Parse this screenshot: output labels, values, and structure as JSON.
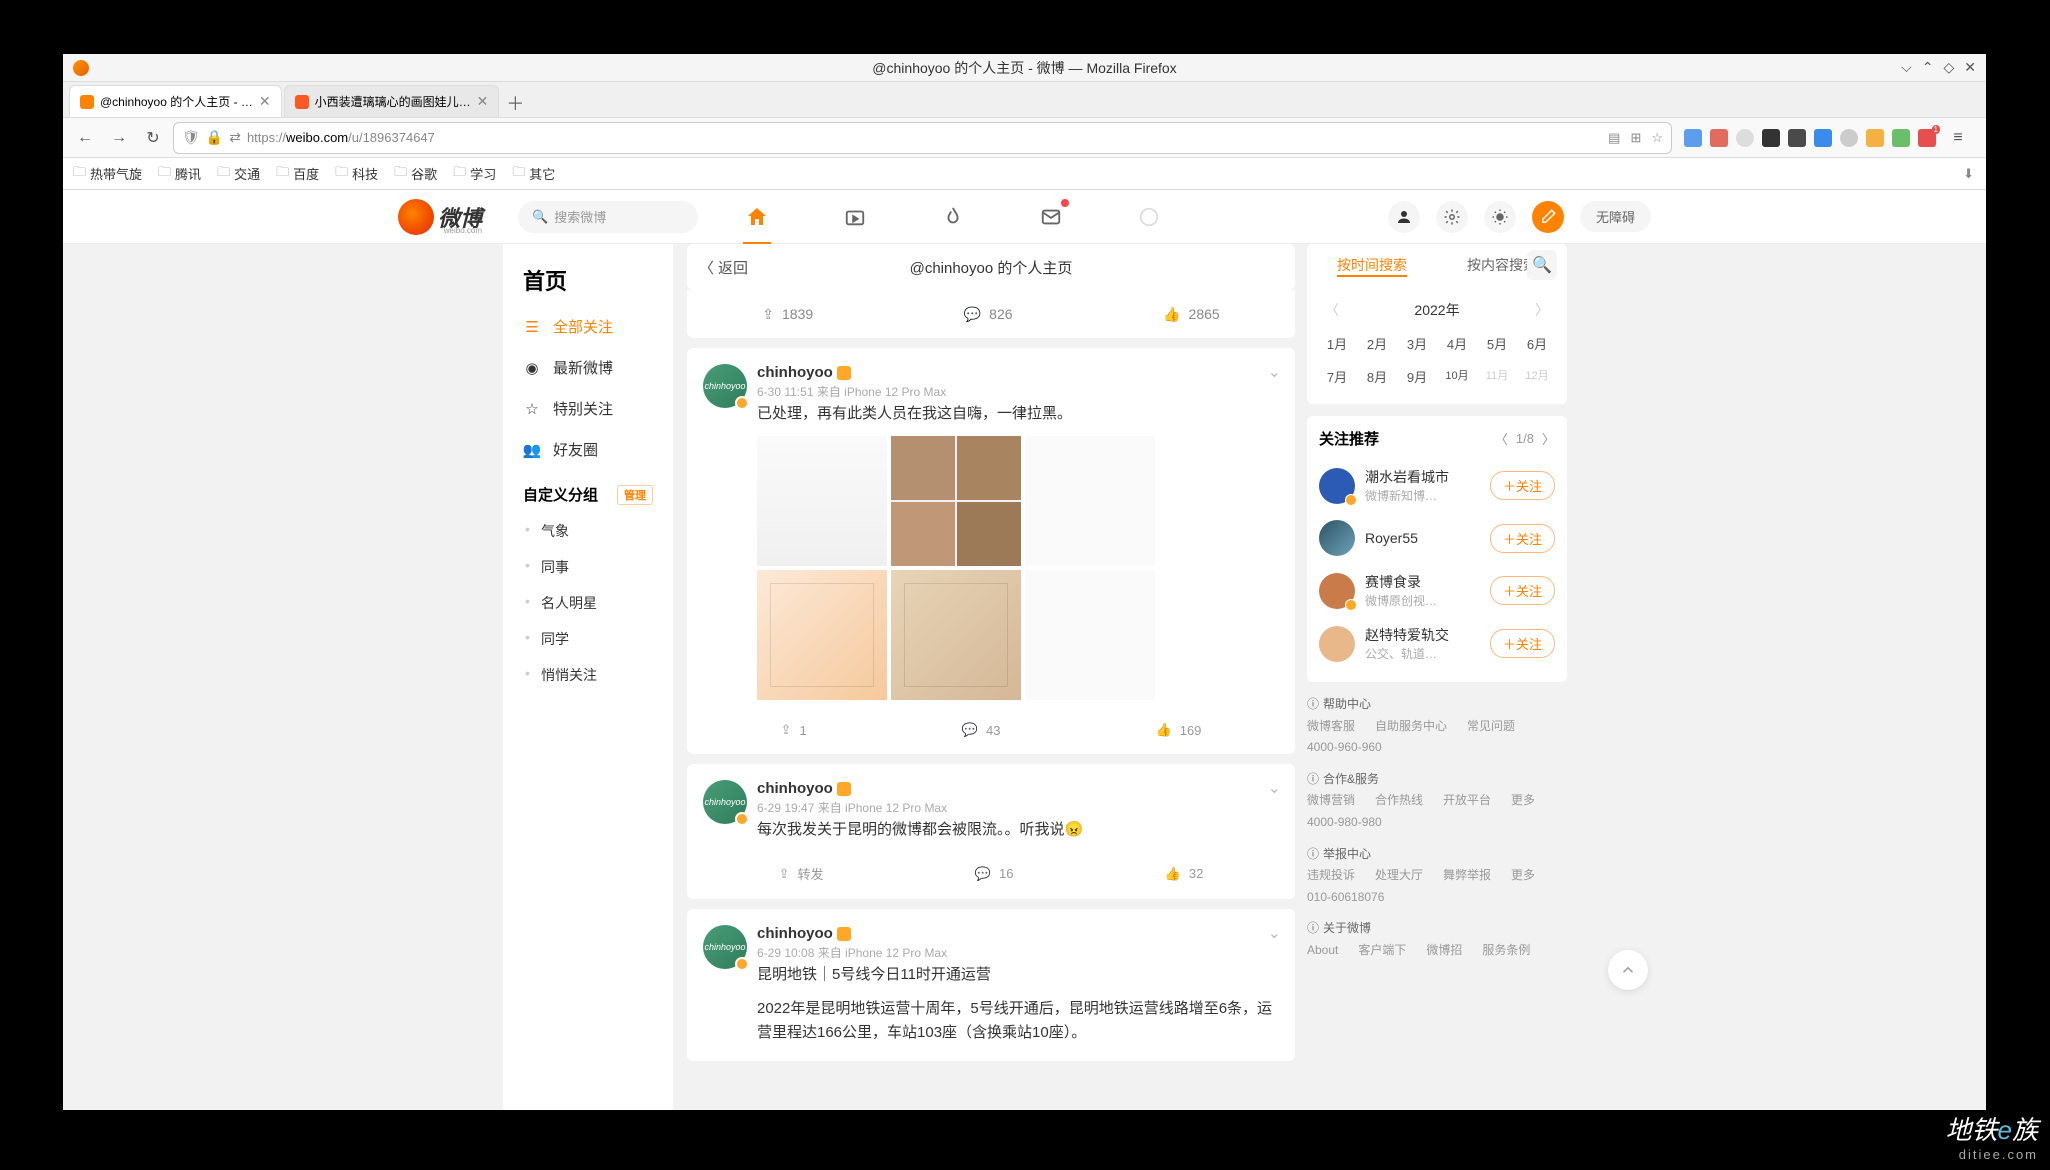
{
  "window": {
    "title": "@chinhoyoo 的个人主页 - 微博 — Mozilla Firefox"
  },
  "tabs": [
    {
      "title": "@chinhoyoo 的个人主页 - …",
      "active": true
    },
    {
      "title": "小西装遭璃璃心的画图娃儿…",
      "active": false
    }
  ],
  "url": {
    "scheme": "https://",
    "host": "weibo.com",
    "path": "/u/1896374647"
  },
  "bookmarks": [
    "热带气旋",
    "腾讯",
    "交通",
    "百度",
    "科技",
    "谷歌",
    "学习",
    "其它"
  ],
  "weibo": {
    "logo_text": "微博",
    "logo_sub": "weibo.com",
    "search_placeholder": "搜索微博",
    "header_right": {
      "accessibility": "无障碍"
    }
  },
  "left_rail": {
    "heading": "首页",
    "items": [
      {
        "label": "全部关注",
        "icon": "list",
        "active": true
      },
      {
        "label": "最新微博",
        "icon": "target"
      },
      {
        "label": "特别关注",
        "icon": "star-person"
      },
      {
        "label": "好友圈",
        "icon": "friends"
      }
    ],
    "custom_heading": "自定义分组",
    "manage": "管理",
    "custom_items": [
      "气象",
      "同事",
      "名人明星",
      "同学",
      "悄悄关注"
    ]
  },
  "center": {
    "back": "返回",
    "title": "@chinhoyoo 的个人主页",
    "top_stats": {
      "repost": "1839",
      "comment": "826",
      "like": "2865"
    },
    "posts": [
      {
        "user": "chinhoyoo",
        "avatar_text": "chinhoyoo",
        "meta": "6-30 11:51 来自 iPhone 12 Pro Max",
        "text": "已处理，再有此类人员在我这自嗨，一律拉黑。",
        "actions": {
          "repost": "1",
          "comment": "43",
          "like": "169"
        },
        "has_images": true
      },
      {
        "user": "chinhoyoo",
        "avatar_text": "chinhoyoo",
        "meta": "6-29 19:47 来自 iPhone 12 Pro Max",
        "text": "每次我发关于昆明的微博都会被限流。。听我说😠",
        "actions": {
          "repost": "转发",
          "comment": "16",
          "like": "32"
        },
        "has_images": false
      },
      {
        "user": "chinhoyoo",
        "avatar_text": "chinhoyoo",
        "meta": "6-29 10:08 来自 iPhone 12 Pro Max",
        "text": "昆明地铁｜5号线今日11时开通运营",
        "text2": "2022年是昆明地铁运营十周年，5号线开通后，昆明地铁运营线路增至6条，运营里程达166公里，车站103座（含换乘站10座）。",
        "actions": null,
        "has_images": false
      }
    ]
  },
  "right": {
    "search_tabs": [
      "按时间搜索",
      "按内容搜索"
    ],
    "calendar": {
      "year": "2022年",
      "row1": [
        "1月",
        "2月",
        "3月",
        "4月",
        "5月",
        "6月"
      ],
      "row2": [
        "7月",
        "8月",
        "9月",
        "10月",
        "11月",
        "12月"
      ]
    },
    "follow": {
      "heading": "关注推荐",
      "page": "1/8",
      "recs": [
        {
          "name": "潮水岩看城市",
          "desc": "微博新知博…",
          "color": "#2b5bb5"
        },
        {
          "name": "Royer55",
          "desc": "",
          "color": "#2e5266"
        },
        {
          "name": "赛博食录",
          "desc": "微博原创视…",
          "color": "#c97b4a"
        },
        {
          "name": "赵特特爱轨交",
          "desc": "公交、轨道…",
          "color": "#e8b88a"
        }
      ],
      "follow_btn": "＋关注"
    },
    "footer": {
      "help": {
        "title": "帮助中心",
        "items": [
          "微博客服",
          "4000-960-960",
          "自助服务中心",
          "常见问题"
        ]
      },
      "coop": {
        "title": "合作&服务",
        "items": [
          "微博营销",
          "合作热线",
          "4000-980-980",
          "开放平台",
          "更多"
        ]
      },
      "report": {
        "title": "举报中心",
        "items": [
          "违规投诉",
          "010-60618076",
          "处理大厅",
          "舞弊举报",
          "更多"
        ]
      },
      "about": {
        "title": "关于微博",
        "items": [
          "About",
          "客户端下",
          "微博招",
          "服务条例"
        ]
      }
    }
  },
  "watermark": {
    "line1_a": "地铁",
    "line1_b": "e",
    "line1_c": "族",
    "line2": "ditiee.com"
  }
}
